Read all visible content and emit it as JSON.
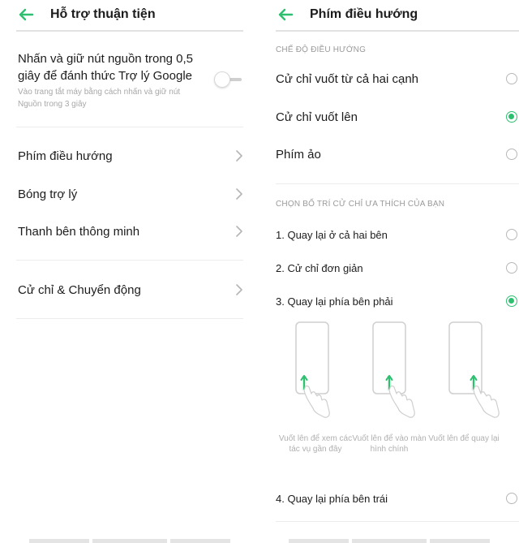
{
  "left": {
    "title": "Hỗ trợ thuận tiện",
    "toggle": {
      "title": "Nhấn và giữ nút nguồn trong 0,5 giây để đánh thức Trợ lý Google",
      "subtitle": "Vào trang tắt máy bằng cách nhấn và giữ nút Nguồn trong 3 giây",
      "enabled": false
    },
    "items": [
      {
        "label": "Phím điều hướng"
      },
      {
        "label": "Bóng trợ lý"
      },
      {
        "label": "Thanh bên thông minh"
      },
      {
        "label": "Cử chỉ & Chuyển động"
      }
    ]
  },
  "right": {
    "title": "Phím điều hướng",
    "section1_label": "CHẾ ĐỘ ĐIỀU HƯỚNG",
    "modes": [
      {
        "label": "Cử chỉ vuốt từ cả hai cạnh",
        "selected": false
      },
      {
        "label": "Cử chỉ vuốt lên",
        "selected": true
      },
      {
        "label": "Phím ảo",
        "selected": false
      }
    ],
    "section2_label": "CHỌN BỐ TRÍ CỬ CHỈ ƯA THÍCH CỦA BẠN",
    "layouts": [
      {
        "label": "1. Quay lại ở cả hai bên",
        "selected": false
      },
      {
        "label": "2. Cử chỉ đơn giản",
        "selected": false
      },
      {
        "label": "3. Quay lại phía bên phải",
        "selected": true
      },
      {
        "label": "4. Quay lại phía bên trái",
        "selected": false
      }
    ],
    "illustrations": [
      {
        "caption": "Vuốt lên để xem các tác vụ gần đây"
      },
      {
        "caption": "Vuốt lên để vào màn hình chính"
      },
      {
        "caption": "Vuốt lên để quay lại"
      }
    ]
  },
  "colors": {
    "accent": "#2fbf71",
    "text": "#1c1c1c",
    "muted": "#a8a8a8",
    "divider": "#ececec"
  },
  "icons": {
    "back": "arrow-left-icon",
    "chevron": "chevron-right-icon",
    "swipe": "hand-swipe-up-icon"
  }
}
